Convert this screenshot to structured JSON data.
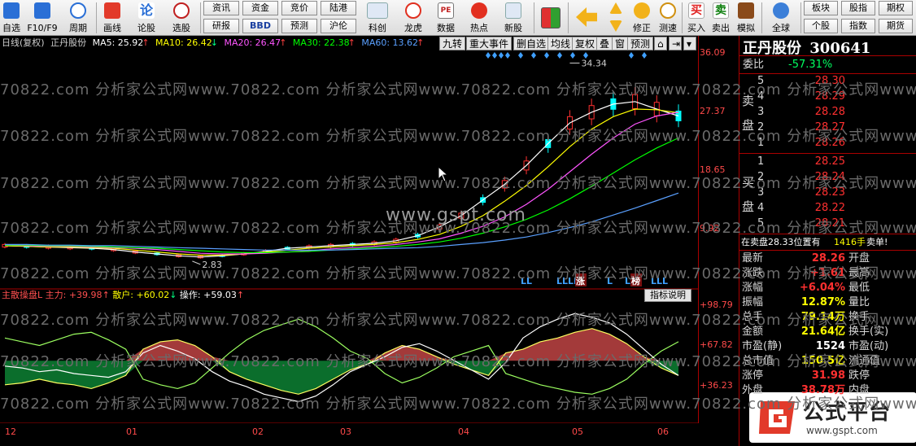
{
  "toolbar": {
    "items": [
      {
        "label": "自选",
        "icon": "stock-list-icon"
      },
      {
        "label": "F10/F9",
        "icon": "f10-info-icon"
      },
      {
        "label": "周期",
        "icon": "period-clock-icon"
      },
      {
        "label": "画线",
        "icon": "draw-line-icon"
      },
      {
        "label": "论股",
        "icon": "discuss-stock-icon"
      },
      {
        "label": "选股",
        "icon": "stock-picker-icon"
      }
    ],
    "boxes_row1": [
      "资讯",
      "资金",
      "竞价",
      "陆港"
    ],
    "boxes_row2": [
      "研报",
      "BBD",
      "预测",
      "沪伦"
    ],
    "items2": [
      {
        "label": "科创",
        "icon": "sci-tech-icon"
      },
      {
        "label": "龙虎",
        "icon": "dragon-tiger-icon"
      },
      {
        "label": "数据",
        "icon": "pe-data-icon"
      },
      {
        "label": "热点",
        "icon": "hotspot-icon"
      },
      {
        "label": "新股",
        "icon": "new-stock-icon"
      }
    ],
    "items3": [
      {
        "label": "修正",
        "icon": "modify-icon"
      },
      {
        "label": "测速",
        "icon": "speed-test-icon"
      },
      {
        "label": "买入",
        "icon": "buy-icon"
      },
      {
        "label": "卖出",
        "icon": "sell-icon"
      },
      {
        "label": "模拟",
        "icon": "simulate-icon"
      },
      {
        "label": "全球",
        "icon": "globe-icon"
      }
    ],
    "buy_char": "买",
    "sell_char": "卖",
    "right_boxes": [
      [
        "板块",
        "股指",
        "期权"
      ],
      [
        "个股",
        "指数",
        "期货"
      ]
    ]
  },
  "stock": {
    "name": "正丹股份",
    "code": "300641"
  },
  "main_info": {
    "period": "日线(复权)",
    "name": "正丹股份",
    "ma5": "MA5: 25.92",
    "ma10": "MA10: 26.42",
    "ma20": "MA20: 26.47",
    "ma30": "MA30: 22.38",
    "ma60": "MA60: 13.62"
  },
  "chart_menu": [
    "九转",
    "重大事件",
    "删自选",
    "均线",
    "复权",
    "叠",
    "窗",
    "预测"
  ],
  "indicator_info": {
    "name": "主散操盘L",
    "main": "主力: +39.98",
    "retail": "散户: +60.02",
    "operate": "操作: +59.03",
    "help": "指标说明"
  },
  "colors": {
    "ma5": "#ffffff",
    "ma10": "#ffff00",
    "ma20": "#ff55ff",
    "ma30": "#00ff00",
    "ma60": "#5aa0ff",
    "up": "#ff3030",
    "down": "#00ffff",
    "axis": "#a00000",
    "main_fill": "#a33a3a",
    "retail_fill": "#0b6e2c"
  },
  "quote": {
    "weibi_label": "委比",
    "weibi_value": "-57.31%",
    "sell_label": [
      "卖",
      "盘"
    ],
    "buy_label": [
      "买",
      "盘"
    ],
    "sells": [
      {
        "lv": "5",
        "price": "28.30"
      },
      {
        "lv": "4",
        "price": "28.29"
      },
      {
        "lv": "3",
        "price": "28.28"
      },
      {
        "lv": "2",
        "price": "28.27"
      },
      {
        "lv": "1",
        "price": "28.26"
      }
    ],
    "buys": [
      {
        "lv": "1",
        "price": "28.25"
      },
      {
        "lv": "2",
        "price": "28.24"
      },
      {
        "lv": "3",
        "price": "28.23"
      },
      {
        "lv": "4",
        "price": "28.22"
      },
      {
        "lv": "5",
        "price": "28.21"
      }
    ],
    "notice_left": "在卖盘28.33位置有",
    "notice_vol": "1416手",
    "notice_right": "卖单!",
    "stats": [
      {
        "l": "最新",
        "v": "28.26",
        "r": "开盘",
        "c": "#ff3030"
      },
      {
        "l": "涨跌",
        "v": "+1.61",
        "r": "最高",
        "c": "#ff3030"
      },
      {
        "l": "涨幅",
        "v": "+6.04%",
        "r": "最低",
        "c": "#ff3030"
      },
      {
        "l": "振幅",
        "v": "12.87%",
        "r": "量比",
        "c": "#ffff00"
      },
      {
        "l": "总手",
        "v": "79.14万",
        "r": "换手",
        "c": "#ffff00"
      },
      {
        "l": "金额",
        "v": "21.64亿",
        "r": "换手(实)",
        "c": "#ffff00"
      },
      {
        "l": "市盈(静)",
        "v": "1524",
        "r": "市盈(动)",
        "c": "#ffffff"
      },
      {
        "l": "总市值",
        "v": "150.5亿",
        "r": "流通值",
        "c": "#ffff00"
      },
      {
        "l": "涨停",
        "v": "31.98",
        "r": "跌停",
        "c": "#ff3030"
      },
      {
        "l": "外盘",
        "v": "38.78万",
        "r": "内盘",
        "c": "#ff3030"
      }
    ]
  },
  "y_main": [
    "36.09",
    "27.37",
    "18.65",
    "9.92"
  ],
  "y_ind": [
    "+98.79",
    "+67.82",
    "+36.23"
  ],
  "x_labels": [
    "12",
    "01",
    "02",
    "03",
    "04",
    "05",
    "06"
  ],
  "annot": {
    "high": "34.34",
    "low": "2.83"
  },
  "markers": [
    "LL",
    "LLLL",
    "涨",
    "L",
    "L",
    "榜",
    "LLL"
  ],
  "watermark": "70822.com 分析家公式网www.70822.com 分析家公式网www.70822.com 分析家公式网www.70822.com 分析家公式网www.70822.com 分析家公式网",
  "site": "www.gspt.com",
  "logo": {
    "name": "公式平台",
    "url": "www.gspt.com"
  },
  "chart_data": {
    "type": "candlestick-with-ma",
    "ylim": [
      0,
      36.09
    ],
    "series": [
      {
        "name": "MA5",
        "values": [
          5.2,
          5.1,
          5.0,
          4.9,
          4.8,
          4.6,
          4.2,
          3.9,
          3.6,
          3.4,
          3.6,
          3.9,
          4.3,
          4.8,
          5.0,
          5.2,
          5.4,
          5.6,
          6.0,
          6.8,
          8.2,
          10.0,
          12.5,
          15.0,
          18.0,
          21.5,
          24.8,
          26.5,
          27.8,
          28.2,
          27.0,
          25.9
        ]
      },
      {
        "name": "MA10",
        "values": [
          5.2,
          5.1,
          5.0,
          5.0,
          4.9,
          4.8,
          4.5,
          4.2,
          3.9,
          3.7,
          3.7,
          3.9,
          4.2,
          4.5,
          4.8,
          5.0,
          5.2,
          5.4,
          5.7,
          6.2,
          7.0,
          8.3,
          10.0,
          12.3,
          14.8,
          17.8,
          21.0,
          23.8,
          25.8,
          27.0,
          26.9,
          26.4
        ]
      },
      {
        "name": "MA20",
        "values": [
          5.3,
          5.2,
          5.1,
          5.1,
          5.0,
          4.9,
          4.8,
          4.6,
          4.3,
          4.0,
          3.9,
          3.9,
          4.0,
          4.2,
          4.4,
          4.7,
          4.9,
          5.1,
          5.4,
          5.8,
          6.3,
          7.2,
          8.3,
          9.8,
          11.8,
          14.2,
          17.0,
          19.8,
          22.4,
          24.6,
          25.9,
          26.5
        ]
      },
      {
        "name": "MA30",
        "values": [
          5.3,
          5.3,
          5.2,
          5.2,
          5.1,
          5.0,
          4.9,
          4.8,
          4.6,
          4.4,
          4.2,
          4.1,
          4.1,
          4.2,
          4.3,
          4.5,
          4.7,
          4.9,
          5.1,
          5.4,
          5.8,
          6.4,
          7.2,
          8.2,
          9.4,
          10.9,
          12.7,
          14.7,
          16.8,
          18.9,
          20.8,
          22.4
        ]
      },
      {
        "name": "MA60",
        "values": [
          5.4,
          5.4,
          5.3,
          5.3,
          5.2,
          5.2,
          5.1,
          5.0,
          4.9,
          4.8,
          4.7,
          4.6,
          4.5,
          4.5,
          4.5,
          4.5,
          4.6,
          4.7,
          4.8,
          4.9,
          5.1,
          5.4,
          5.7,
          6.1,
          6.6,
          7.3,
          8.1,
          9.0,
          10.1,
          11.2,
          12.4,
          13.6
        ]
      }
    ],
    "indicator": {
      "type": "area",
      "ylim": [
        36.23,
        98.79
      ],
      "base": 67.82,
      "main": [
        55,
        56,
        58,
        56,
        55,
        53,
        56,
        60,
        74,
        78,
        79,
        76,
        70,
        62,
        58,
        55,
        52,
        50,
        53,
        58,
        63,
        66,
        72,
        76,
        74,
        70,
        66,
        63,
        60,
        72,
        74,
        78,
        80,
        83,
        85,
        82,
        77,
        70,
        64,
        60
      ],
      "retail": [
        80,
        78,
        76,
        79,
        82,
        83,
        79,
        74,
        58,
        55,
        53,
        56,
        64,
        72,
        79,
        84,
        87,
        90,
        86,
        80,
        73,
        69,
        61,
        56,
        59,
        64,
        70,
        73,
        76,
        61,
        58,
        55,
        53,
        51,
        50,
        53,
        58,
        66,
        73,
        78
      ],
      "operate": [
        65,
        64,
        62,
        63,
        61,
        60,
        59,
        62,
        72,
        76,
        73,
        69,
        62,
        57,
        54,
        50,
        48,
        46,
        49,
        55,
        62,
        66,
        70,
        75,
        77,
        73,
        68,
        63,
        58,
        67,
        80,
        86,
        90,
        93,
        91,
        88,
        82,
        74,
        66,
        60
      ]
    }
  }
}
